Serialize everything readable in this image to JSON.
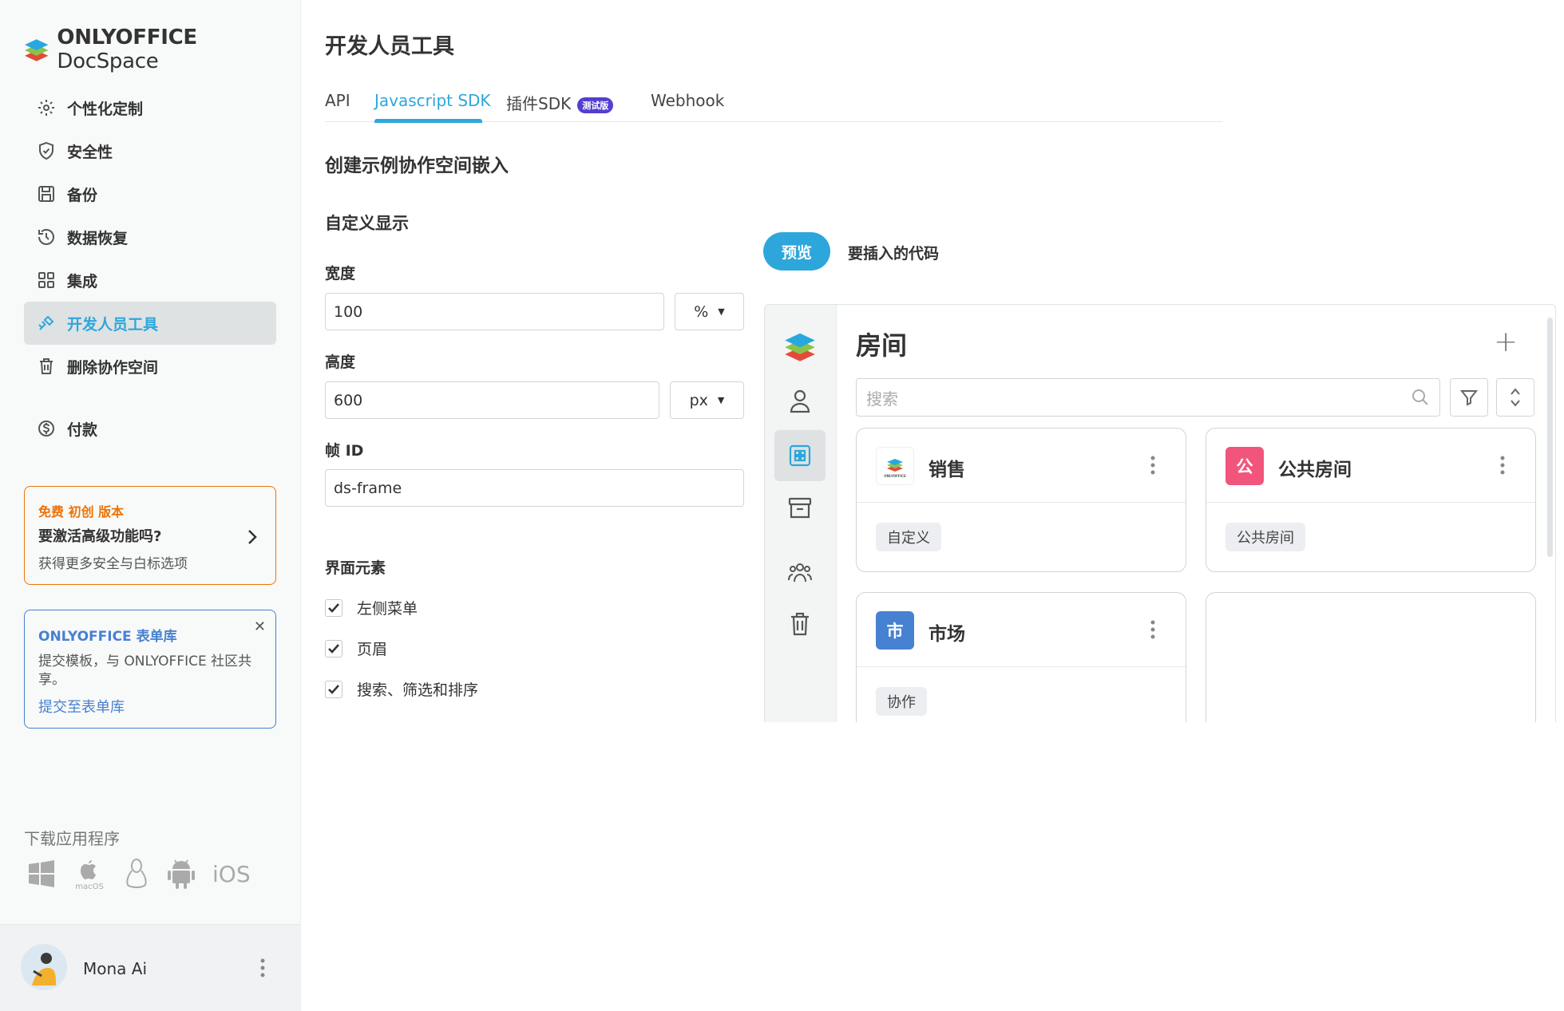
{
  "app": {
    "logo_brand": "ONLYOFFICE",
    "logo_product": " DocSpace"
  },
  "sidebar": {
    "items": [
      {
        "label": "个性化定制",
        "icon": "gear-icon"
      },
      {
        "label": "安全性",
        "icon": "shield-icon"
      },
      {
        "label": "备份",
        "icon": "save-icon"
      },
      {
        "label": "数据恢复",
        "icon": "restore-icon"
      },
      {
        "label": "集成",
        "icon": "grid-icon"
      },
      {
        "label": "开发人员工具",
        "icon": "developer-tools-icon",
        "active": true
      },
      {
        "label": "删除协作空间",
        "icon": "trash-icon"
      },
      {
        "label": "付款",
        "icon": "dollar-icon"
      }
    ],
    "promo": {
      "top": "免费 初创 版本",
      "title": "要激活高级功能吗?",
      "subtitle": "获得更多安全与白标选项"
    },
    "forms": {
      "title": "ONLYOFFICE 表单库",
      "text": "提交模板，与 ONLYOFFICE 社区共享。",
      "link": "提交至表单库"
    },
    "apps_label": "下载应用程序",
    "apps_ios": "iOS",
    "apps_macos": "macOS",
    "user_name": "Mona Ai"
  },
  "main": {
    "title": "开发人员工具",
    "tabs": [
      {
        "label": "API"
      },
      {
        "label": "Javascript SDK",
        "active": true
      },
      {
        "label": "插件SDK",
        "badge": "测试版"
      },
      {
        "label": "Webhook"
      }
    ],
    "section_title": "创建示例协作空间嵌入",
    "subsection": "自定义显示",
    "width_label": "宽度",
    "width_value": "100",
    "width_unit": "%",
    "height_label": "高度",
    "height_value": "600",
    "height_unit": "px",
    "frame_id_label": "帧 ID",
    "frame_id_value": "ds-frame",
    "ui_elements_label": "界面元素",
    "checkboxes": [
      {
        "label": "左侧菜单",
        "checked": true
      },
      {
        "label": "页眉",
        "checked": true
      },
      {
        "label": "搜索、筛选和排序",
        "checked": true
      }
    ]
  },
  "preview": {
    "preview_tab": "预览",
    "code_tab": "要插入的代码",
    "title": "房间",
    "search_placeholder": "搜索",
    "rooms": [
      {
        "name": "销售",
        "tag": "自定义",
        "logo_type": "onlyoffice",
        "logo_text": "ONLYOFFICE"
      },
      {
        "name": "公共房间",
        "tag": "公共房间",
        "logo_type": "letter",
        "letter": "公",
        "color": "#f2557c"
      },
      {
        "name": "市场",
        "tag": "协作",
        "logo_type": "letter",
        "letter": "市",
        "color": "#4781d1"
      }
    ]
  },
  "colors": {
    "accent": "#2da7db",
    "promo": "#ed7309",
    "forms": "#4781d1",
    "beta": "#533ed1"
  }
}
